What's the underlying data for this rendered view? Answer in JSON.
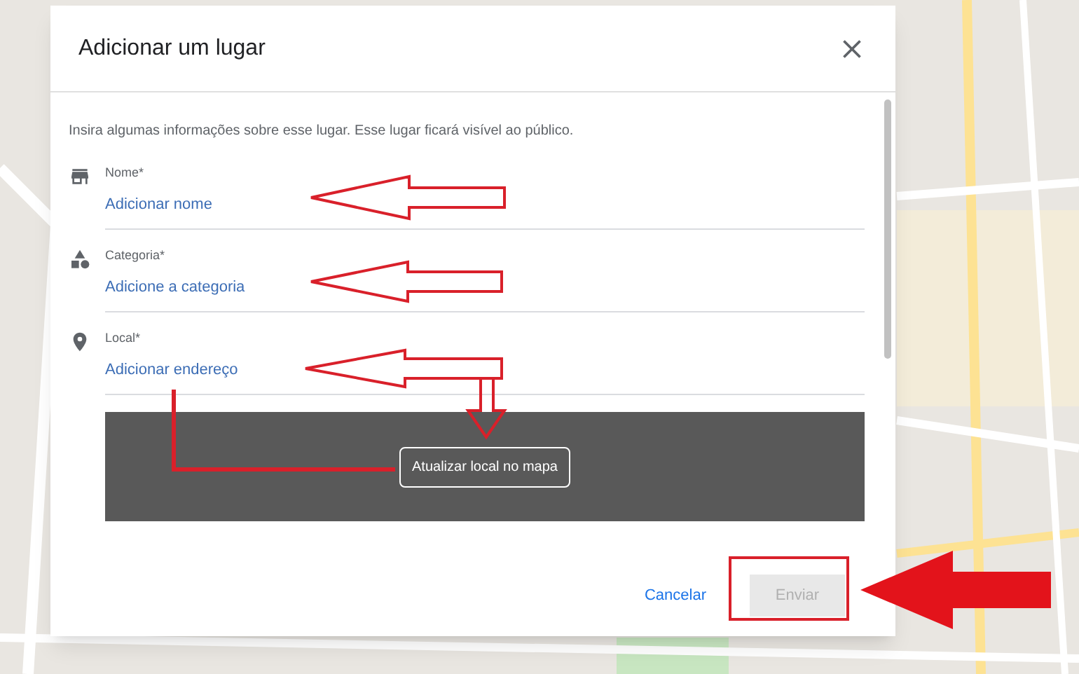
{
  "dialog": {
    "title": "Adicionar um lugar",
    "intro": "Insira algumas informações sobre esse lugar. Esse lugar ficará visível ao público.",
    "fields": [
      {
        "kind": "store",
        "label": "Nome*",
        "placeholder": "Adicionar nome"
      },
      {
        "kind": "category",
        "label": "Categoria*",
        "placeholder": "Adicione a categoria"
      },
      {
        "kind": "place",
        "label": "Local*",
        "placeholder": "Adicionar endereço"
      }
    ],
    "map_preview": {
      "button": "Atualizar local no mapa"
    },
    "buttons": [
      {
        "kind": "text",
        "label": "Cancelar",
        "disabled": false
      },
      {
        "kind": "primary",
        "label": "Enviar",
        "disabled": true
      }
    ]
  }
}
